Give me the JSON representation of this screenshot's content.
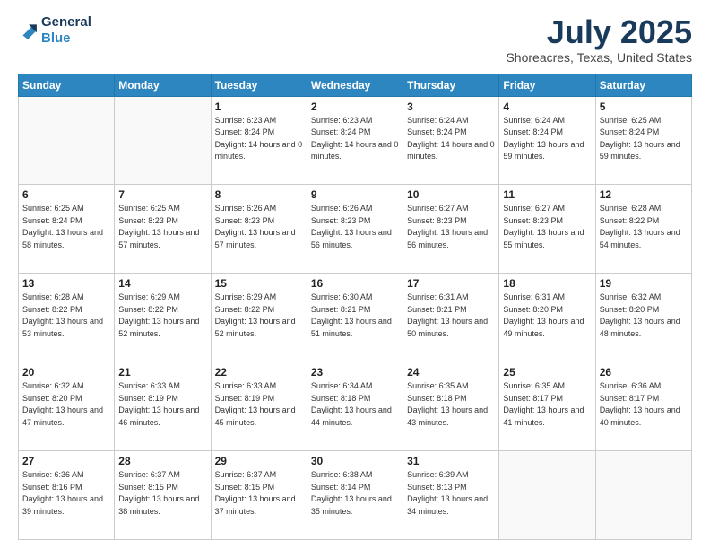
{
  "logo": {
    "line1": "General",
    "line2": "Blue"
  },
  "title": "July 2025",
  "subtitle": "Shoreacres, Texas, United States",
  "headers": [
    "Sunday",
    "Monday",
    "Tuesday",
    "Wednesday",
    "Thursday",
    "Friday",
    "Saturday"
  ],
  "weeks": [
    [
      {
        "day": "",
        "sunrise": "",
        "sunset": "",
        "daylight": ""
      },
      {
        "day": "",
        "sunrise": "",
        "sunset": "",
        "daylight": ""
      },
      {
        "day": "1",
        "sunrise": "Sunrise: 6:23 AM",
        "sunset": "Sunset: 8:24 PM",
        "daylight": "Daylight: 14 hours and 0 minutes."
      },
      {
        "day": "2",
        "sunrise": "Sunrise: 6:23 AM",
        "sunset": "Sunset: 8:24 PM",
        "daylight": "Daylight: 14 hours and 0 minutes."
      },
      {
        "day": "3",
        "sunrise": "Sunrise: 6:24 AM",
        "sunset": "Sunset: 8:24 PM",
        "daylight": "Daylight: 14 hours and 0 minutes."
      },
      {
        "day": "4",
        "sunrise": "Sunrise: 6:24 AM",
        "sunset": "Sunset: 8:24 PM",
        "daylight": "Daylight: 13 hours and 59 minutes."
      },
      {
        "day": "5",
        "sunrise": "Sunrise: 6:25 AM",
        "sunset": "Sunset: 8:24 PM",
        "daylight": "Daylight: 13 hours and 59 minutes."
      }
    ],
    [
      {
        "day": "6",
        "sunrise": "Sunrise: 6:25 AM",
        "sunset": "Sunset: 8:24 PM",
        "daylight": "Daylight: 13 hours and 58 minutes."
      },
      {
        "day": "7",
        "sunrise": "Sunrise: 6:25 AM",
        "sunset": "Sunset: 8:23 PM",
        "daylight": "Daylight: 13 hours and 57 minutes."
      },
      {
        "day": "8",
        "sunrise": "Sunrise: 6:26 AM",
        "sunset": "Sunset: 8:23 PM",
        "daylight": "Daylight: 13 hours and 57 minutes."
      },
      {
        "day": "9",
        "sunrise": "Sunrise: 6:26 AM",
        "sunset": "Sunset: 8:23 PM",
        "daylight": "Daylight: 13 hours and 56 minutes."
      },
      {
        "day": "10",
        "sunrise": "Sunrise: 6:27 AM",
        "sunset": "Sunset: 8:23 PM",
        "daylight": "Daylight: 13 hours and 56 minutes."
      },
      {
        "day": "11",
        "sunrise": "Sunrise: 6:27 AM",
        "sunset": "Sunset: 8:23 PM",
        "daylight": "Daylight: 13 hours and 55 minutes."
      },
      {
        "day": "12",
        "sunrise": "Sunrise: 6:28 AM",
        "sunset": "Sunset: 8:22 PM",
        "daylight": "Daylight: 13 hours and 54 minutes."
      }
    ],
    [
      {
        "day": "13",
        "sunrise": "Sunrise: 6:28 AM",
        "sunset": "Sunset: 8:22 PM",
        "daylight": "Daylight: 13 hours and 53 minutes."
      },
      {
        "day": "14",
        "sunrise": "Sunrise: 6:29 AM",
        "sunset": "Sunset: 8:22 PM",
        "daylight": "Daylight: 13 hours and 52 minutes."
      },
      {
        "day": "15",
        "sunrise": "Sunrise: 6:29 AM",
        "sunset": "Sunset: 8:22 PM",
        "daylight": "Daylight: 13 hours and 52 minutes."
      },
      {
        "day": "16",
        "sunrise": "Sunrise: 6:30 AM",
        "sunset": "Sunset: 8:21 PM",
        "daylight": "Daylight: 13 hours and 51 minutes."
      },
      {
        "day": "17",
        "sunrise": "Sunrise: 6:31 AM",
        "sunset": "Sunset: 8:21 PM",
        "daylight": "Daylight: 13 hours and 50 minutes."
      },
      {
        "day": "18",
        "sunrise": "Sunrise: 6:31 AM",
        "sunset": "Sunset: 8:20 PM",
        "daylight": "Daylight: 13 hours and 49 minutes."
      },
      {
        "day": "19",
        "sunrise": "Sunrise: 6:32 AM",
        "sunset": "Sunset: 8:20 PM",
        "daylight": "Daylight: 13 hours and 48 minutes."
      }
    ],
    [
      {
        "day": "20",
        "sunrise": "Sunrise: 6:32 AM",
        "sunset": "Sunset: 8:20 PM",
        "daylight": "Daylight: 13 hours and 47 minutes."
      },
      {
        "day": "21",
        "sunrise": "Sunrise: 6:33 AM",
        "sunset": "Sunset: 8:19 PM",
        "daylight": "Daylight: 13 hours and 46 minutes."
      },
      {
        "day": "22",
        "sunrise": "Sunrise: 6:33 AM",
        "sunset": "Sunset: 8:19 PM",
        "daylight": "Daylight: 13 hours and 45 minutes."
      },
      {
        "day": "23",
        "sunrise": "Sunrise: 6:34 AM",
        "sunset": "Sunset: 8:18 PM",
        "daylight": "Daylight: 13 hours and 44 minutes."
      },
      {
        "day": "24",
        "sunrise": "Sunrise: 6:35 AM",
        "sunset": "Sunset: 8:18 PM",
        "daylight": "Daylight: 13 hours and 43 minutes."
      },
      {
        "day": "25",
        "sunrise": "Sunrise: 6:35 AM",
        "sunset": "Sunset: 8:17 PM",
        "daylight": "Daylight: 13 hours and 41 minutes."
      },
      {
        "day": "26",
        "sunrise": "Sunrise: 6:36 AM",
        "sunset": "Sunset: 8:17 PM",
        "daylight": "Daylight: 13 hours and 40 minutes."
      }
    ],
    [
      {
        "day": "27",
        "sunrise": "Sunrise: 6:36 AM",
        "sunset": "Sunset: 8:16 PM",
        "daylight": "Daylight: 13 hours and 39 minutes."
      },
      {
        "day": "28",
        "sunrise": "Sunrise: 6:37 AM",
        "sunset": "Sunset: 8:15 PM",
        "daylight": "Daylight: 13 hours and 38 minutes."
      },
      {
        "day": "29",
        "sunrise": "Sunrise: 6:37 AM",
        "sunset": "Sunset: 8:15 PM",
        "daylight": "Daylight: 13 hours and 37 minutes."
      },
      {
        "day": "30",
        "sunrise": "Sunrise: 6:38 AM",
        "sunset": "Sunset: 8:14 PM",
        "daylight": "Daylight: 13 hours and 35 minutes."
      },
      {
        "day": "31",
        "sunrise": "Sunrise: 6:39 AM",
        "sunset": "Sunset: 8:13 PM",
        "daylight": "Daylight: 13 hours and 34 minutes."
      },
      {
        "day": "",
        "sunrise": "",
        "sunset": "",
        "daylight": ""
      },
      {
        "day": "",
        "sunrise": "",
        "sunset": "",
        "daylight": ""
      }
    ]
  ]
}
